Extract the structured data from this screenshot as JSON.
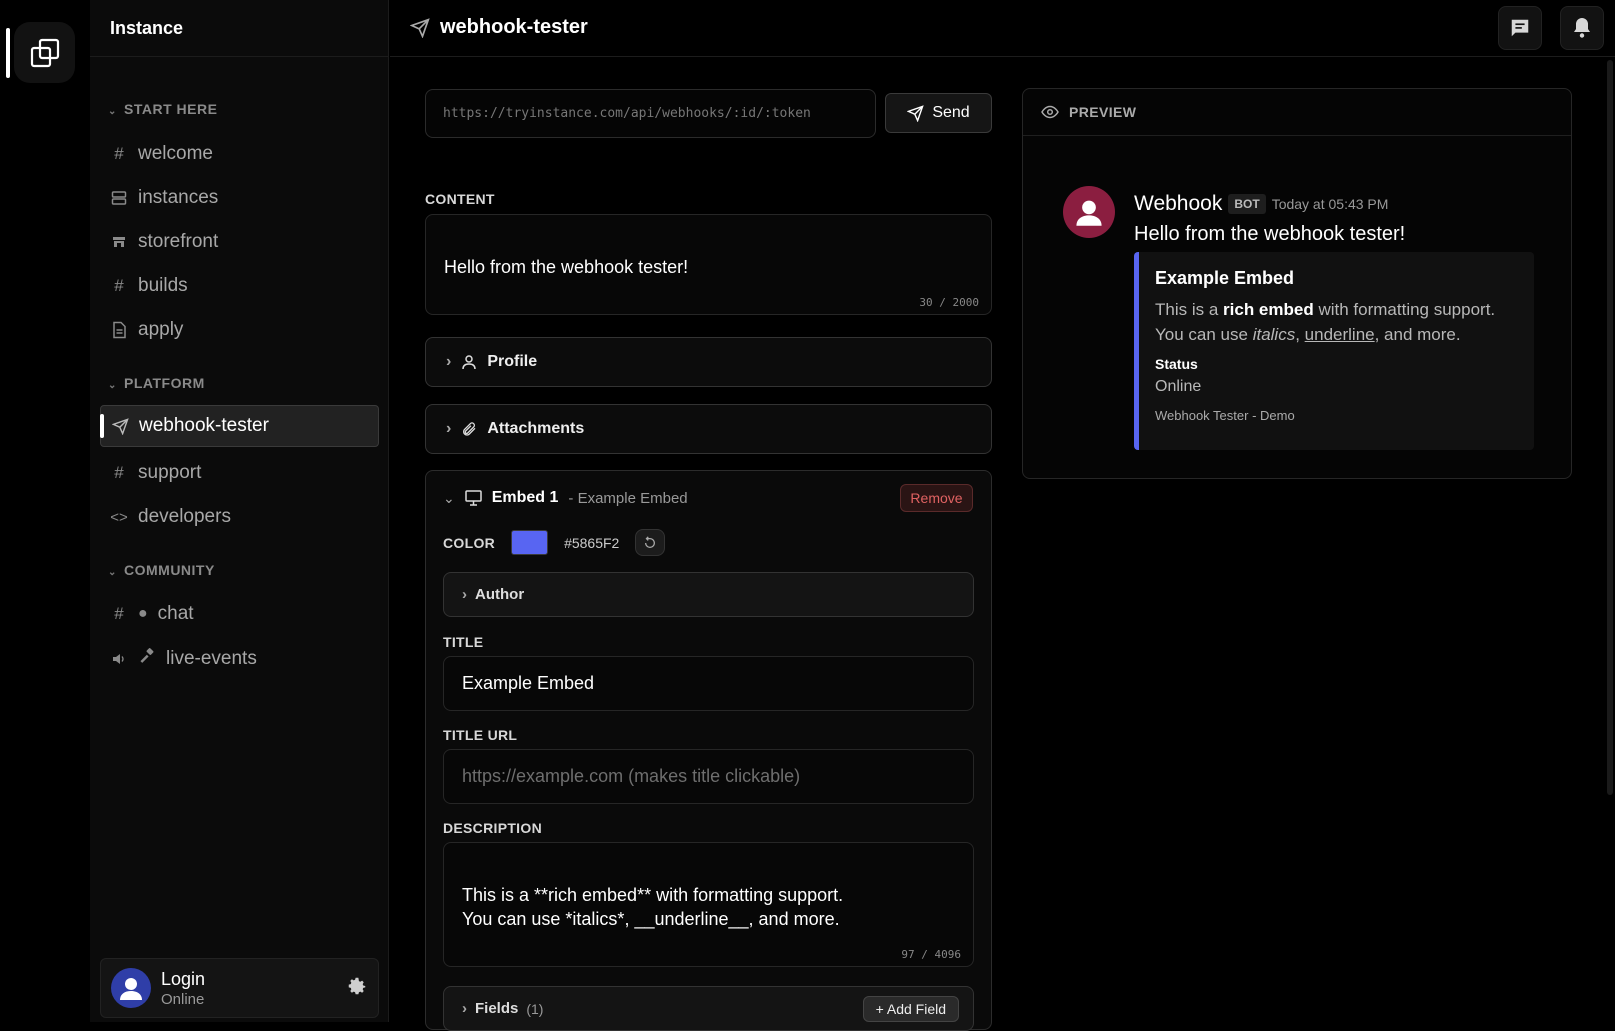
{
  "app": {
    "name": "Instance"
  },
  "sidebar": {
    "sections": [
      {
        "label": "START HERE"
      },
      {
        "label": "PLATFORM"
      },
      {
        "label": "COMMUNITY"
      }
    ],
    "items": [
      {
        "label": "welcome",
        "icon": "hash-icon"
      },
      {
        "label": "instances",
        "icon": "server-icon"
      },
      {
        "label": "storefront",
        "icon": "store-icon"
      },
      {
        "label": "builds",
        "icon": "hash-icon"
      },
      {
        "label": "apply",
        "icon": "document-icon"
      },
      {
        "label": "webhook-tester",
        "icon": "send-icon",
        "active": true
      },
      {
        "label": "support",
        "icon": "hash-icon"
      },
      {
        "label": "developers",
        "icon": "code-icon"
      },
      {
        "label": "chat",
        "icon": "chat-bubble-icon"
      },
      {
        "label": "live-events",
        "icon": "speaker-icon"
      }
    ],
    "user": {
      "name": "Login",
      "status": "Online"
    }
  },
  "topbar": {
    "title": "webhook-tester"
  },
  "form": {
    "url_placeholder": "https://tryinstance.com/api/webhooks/:id/:token",
    "send_label": "Send",
    "content_label": "CONTENT",
    "content_value": "Hello from the webhook tester!",
    "content_counter": "30 / 2000",
    "profile_label": "Profile",
    "attachments_label": "Attachments"
  },
  "embed": {
    "name": "Embed 1",
    "subtitle": "- Example Embed",
    "remove_label": "Remove",
    "color_label": "COLOR",
    "color_hex": "#5865F2",
    "author_label": "Author",
    "title_label": "TITLE",
    "title_value": "Example Embed",
    "title_url_label": "TITLE URL",
    "title_url_placeholder": "https://example.com (makes title clickable)",
    "description_label": "DESCRIPTION",
    "description_value": "This is a **rich embed** with formatting support.\nYou can use *italics*, __underline__, and more.",
    "description_counter": "97 / 4096",
    "fields_label": "Fields",
    "fields_count": "(1)",
    "add_field_label": "+ Add Field"
  },
  "preview": {
    "header": "PREVIEW",
    "author": "Webhook",
    "bot_tag": "BOT",
    "time": "Today at 05:43 PM",
    "content": "Hello from the webhook tester!",
    "embed_title": "Example Embed",
    "desc_line1_a": "This is a ",
    "desc_line1_b": "rich embed",
    "desc_line1_c": " with formatting support.",
    "desc_line2_a": "You can use ",
    "desc_line2_b": "italics",
    "desc_line2_c": ", ",
    "desc_line2_d": "underline",
    "desc_line2_e": ", and more.",
    "field_name": "Status",
    "field_value": "Online",
    "footer": "Webhook Tester - Demo",
    "accent": "#5865F2",
    "avatar_color": "#8b1e40"
  }
}
